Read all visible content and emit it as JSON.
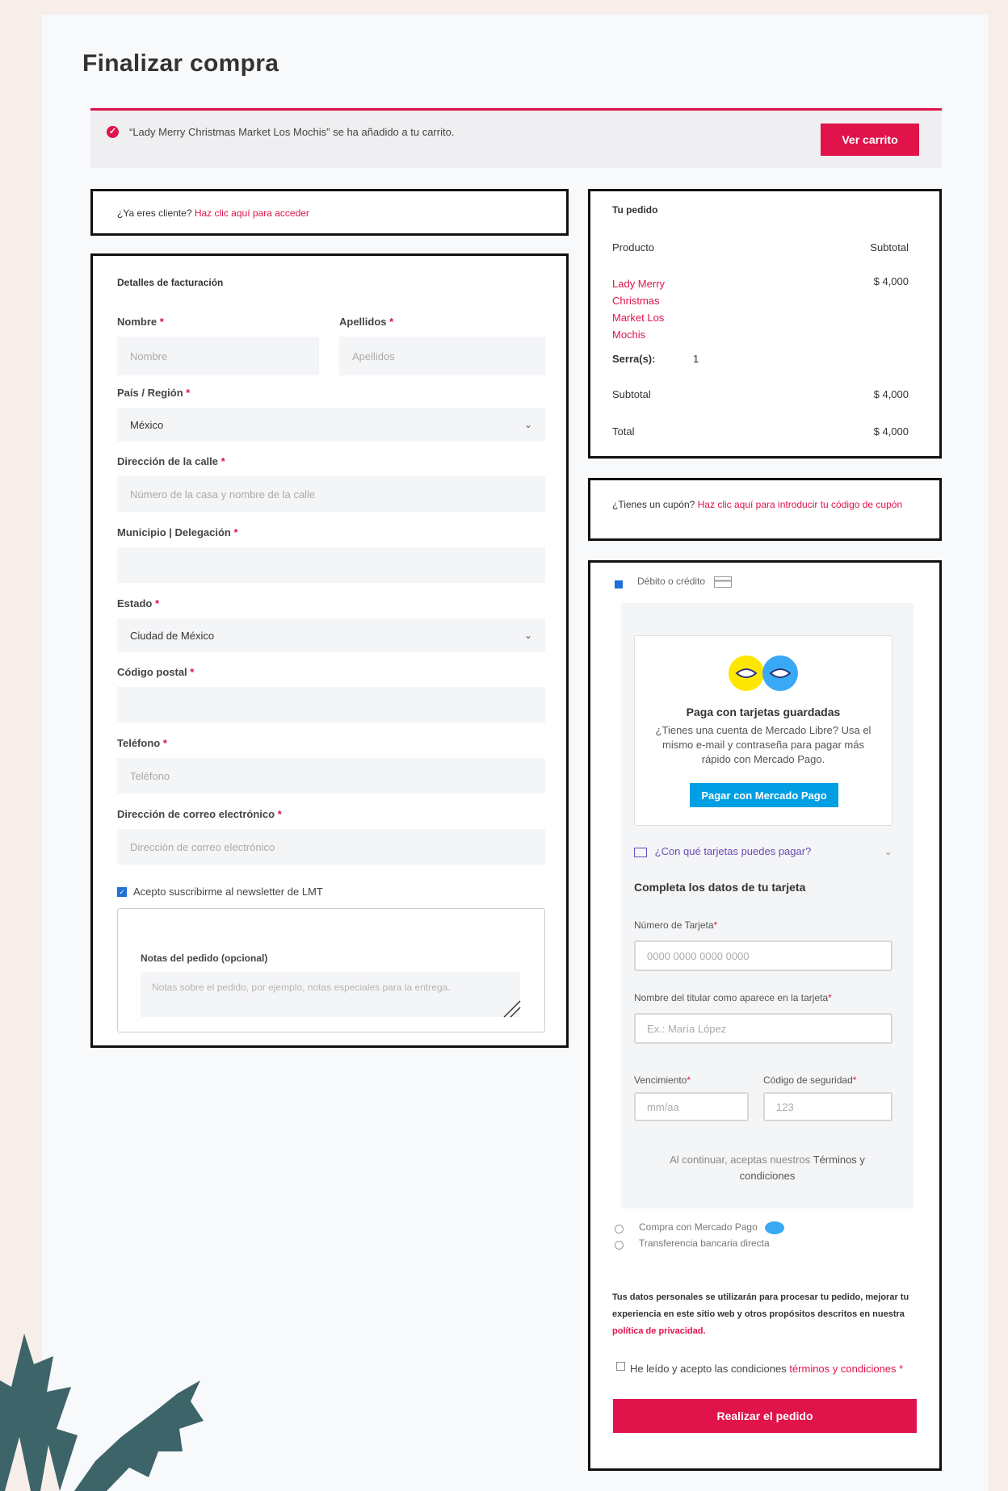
{
  "page": {
    "title": "Finalizar compra"
  },
  "notice": {
    "text": "“Lady Merry Christmas Market Los Mochis” se ha añadido a tu carrito.",
    "button": "Ver carrito"
  },
  "login": {
    "prompt": "¿Ya eres cliente?",
    "link": "Haz clic aquí para acceder"
  },
  "billing": {
    "title": "Detalles de facturación",
    "first_name": {
      "label": "Nombre",
      "placeholder": "Nombre"
    },
    "last_name": {
      "label": "Apellidos",
      "placeholder": "Apellidos"
    },
    "country": {
      "label": "País / Región",
      "value": "México"
    },
    "street": {
      "label": "Dirección de la calle",
      "placeholder": "Número de la casa y nombre de la calle"
    },
    "municipality": {
      "label": "Municipio | Delegación",
      "placeholder": ""
    },
    "state": {
      "label": "Estado",
      "value": "Ciudad de México"
    },
    "postcode": {
      "label": "Código postal",
      "placeholder": ""
    },
    "phone": {
      "label": "Teléfono",
      "placeholder": "Teléfono"
    },
    "email": {
      "label": "Dirección de correo electrónico",
      "placeholder": "Dirección de correo electrónico"
    },
    "newsletter": {
      "label": "Acepto suscribirme al newsletter de LMT",
      "checked": true
    },
    "notes": {
      "label": "Notas del pedido (opcional)",
      "placeholder": "Notas sobre el pedido, por ejemplo, notas especiales para la entrega."
    },
    "required_mark": "*"
  },
  "order": {
    "title": "Tu pedido",
    "col_product": "Producto",
    "col_subtotal": "Subtotal",
    "item_name_lines": [
      "Lady Merry",
      "Christmas",
      "Market Los",
      "Mochis"
    ],
    "item_price": "$ 4,000",
    "meta_label": "Serra(s):",
    "meta_value": "1",
    "subtotal_label": "Subtotal",
    "subtotal_value": "$ 4,000",
    "total_label": "Total",
    "total_value": "$ 4,000"
  },
  "coupon": {
    "prompt": "¿Tienes un cupón?",
    "link": "Haz clic aquí para introducir tu código de cupón"
  },
  "payment": {
    "method_card": "Débito o crédito",
    "saved_cards_title": "Paga con tarjetas guardadas",
    "saved_cards_desc": "¿Tienes una cuenta de Mercado Libre? Usa el mismo e-mail y contraseña para pagar más rápido con Mercado Pago.",
    "mp_button": "Pagar con Mercado Pago",
    "which_cards": "¿Con qué tarjetas puedes pagar?",
    "form_title": "Completa los datos de tu tarjeta",
    "card_number": {
      "label": "Número de Tarjeta",
      "placeholder": "0000 0000 0000 0000"
    },
    "holder": {
      "label": "Nombre del titular como aparece en la tarjeta",
      "placeholder": "Ex.: María López"
    },
    "expiry": {
      "label": "Vencimiento",
      "placeholder": "mm/aa"
    },
    "cvv": {
      "label": "Código de seguridad",
      "placeholder": "123"
    },
    "terms_prefix": "Al continuar, aceptas nuestros",
    "terms_link": "Términos y condiciones",
    "method_mp": "Compra con Mercado Pago",
    "method_transfer": "Transferencia bancaria directa",
    "privacy_text": "Tus datos personales se utilizarán para procesar tu pedido, mejorar tu experiencia en este sitio web y otros propósitos descritos en nuestra",
    "privacy_link": "política de privacidad.",
    "accept_text": "He leído y acepto las condiciones",
    "accept_link": "términos y condiciones",
    "place_order": "Realizar el pedido"
  },
  "colors": {
    "accent": "#e0134a",
    "mp_blue": "#009ee3",
    "holly": "#3d6469"
  }
}
